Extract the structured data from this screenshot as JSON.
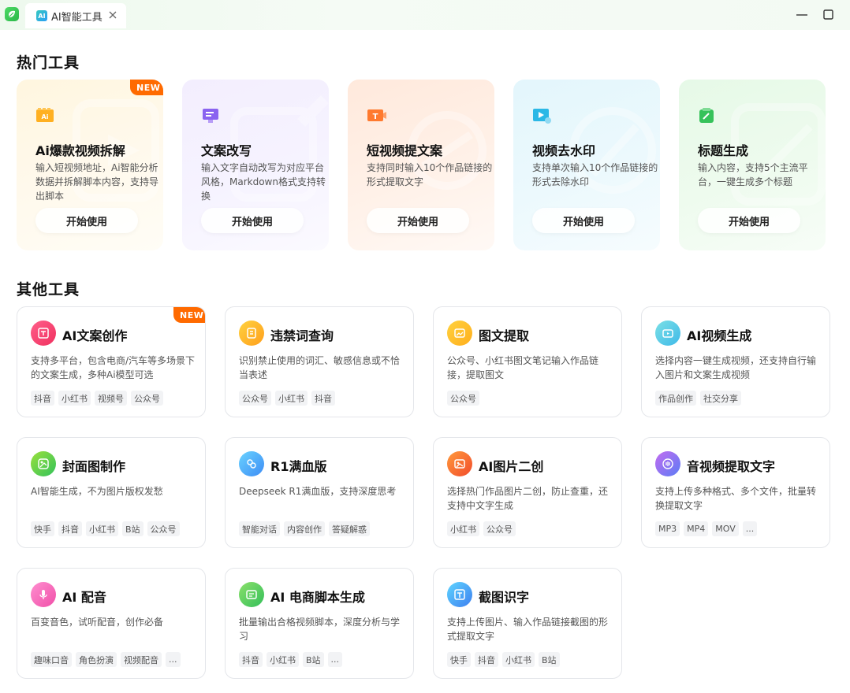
{
  "window": {
    "tab_label": "AI智能工具",
    "tab_icon_text": "AI"
  },
  "sections": {
    "hot_title": "热门工具",
    "other_title": "其他工具"
  },
  "badge_new": "NEW",
  "hot_tools": [
    {
      "title": "Ai爆款视频拆解",
      "desc": "输入短视频地址，Ai智能分析数据并拆解脚本内容，支持导出脚本",
      "button": "开始使用",
      "icon": "video-split-icon",
      "new": true
    },
    {
      "title": "文案改写",
      "desc": "输入文字自动改写为对应平台风格，Markdown格式支持转换",
      "button": "开始使用",
      "icon": "rewrite-icon",
      "new": false
    },
    {
      "title": "短视频提文案",
      "desc": "支持同时输入10个作品链接的形式提取文字",
      "button": "开始使用",
      "icon": "text-extract-icon",
      "new": false
    },
    {
      "title": "视频去水印",
      "desc": "支持单次输入10个作品链接的形式去除水印",
      "button": "开始使用",
      "icon": "watermark-remove-icon",
      "new": false
    },
    {
      "title": "标题生成",
      "desc": "输入内容，支持5个主流平台，一键生成多个标题",
      "button": "开始使用",
      "icon": "title-generate-icon",
      "new": false
    }
  ],
  "other_tools": [
    {
      "title": "AI文案创作",
      "desc": "支持多平台，包含电商/汽车等多场景下的文案生成，多种Ai模型可选",
      "tags": [
        "抖音",
        "小红书",
        "视频号",
        "公众号"
      ],
      "icon": "copywriting-icon",
      "new": true
    },
    {
      "title": "违禁词查询",
      "desc": "识别禁止使用的词汇、敏感信息或不恰当表述",
      "tags": [
        "公众号",
        "小红书",
        "抖音"
      ],
      "icon": "forbidden-word-icon",
      "new": false
    },
    {
      "title": "图文提取",
      "desc": "公众号、小红书图文笔记输入作品链接，提取图文",
      "tags": [
        "公众号"
      ],
      "icon": "image-text-icon",
      "new": false
    },
    {
      "title": "AI视频生成",
      "desc": "选择内容一键生成视频，还支持自行输入图片和文案生成视频",
      "tags": [
        "作品创作",
        "社交分享"
      ],
      "icon": "video-generate-icon",
      "new": false
    },
    {
      "title": "封面图制作",
      "desc": "AI智能生成，不为图片版权发愁",
      "tags": [
        "快手",
        "抖音",
        "小红书",
        "B站",
        "公众号"
      ],
      "icon": "cover-image-icon",
      "new": false
    },
    {
      "title": "R1满血版",
      "desc": "Deepseek R1满血版，支持深度思考",
      "tags": [
        "智能对话",
        "内容创作",
        "答疑解惑"
      ],
      "icon": "deepseek-icon",
      "new": false
    },
    {
      "title": "AI图片二创",
      "desc": "选择热门作品图片二创，防止查重，还支持中文字生成",
      "tags": [
        "小红书",
        "公众号"
      ],
      "icon": "image-remix-icon",
      "new": false
    },
    {
      "title": "音视频提取文字",
      "desc": "支持上传多种格式、多个文件，批量转换提取文字",
      "tags": [
        "MP3",
        "MP4",
        "MOV",
        "..."
      ],
      "icon": "audio-text-icon",
      "new": false
    },
    {
      "title": "AI 配音",
      "desc": "百变音色，试听配音，创作必备",
      "tags": [
        "趣味口音",
        "角色扮演",
        "视频配音",
        "..."
      ],
      "icon": "microphone-icon",
      "new": false
    },
    {
      "title": "AI 电商脚本生成",
      "desc": "批量输出合格视频脚本，深度分析与学习",
      "tags": [
        "抖音",
        "小红书",
        "B站",
        "..."
      ],
      "icon": "ecommerce-script-icon",
      "new": false
    },
    {
      "title": "截图识字",
      "desc": "支持上传图片、输入作品链接截图的形式提取文字",
      "tags": [
        "快手",
        "抖音",
        "小红书",
        "B站"
      ],
      "icon": "screenshot-ocr-icon",
      "new": false
    }
  ],
  "colors": {
    "accent_new": "#ff6a00",
    "brand_green": "#2bb84a"
  }
}
